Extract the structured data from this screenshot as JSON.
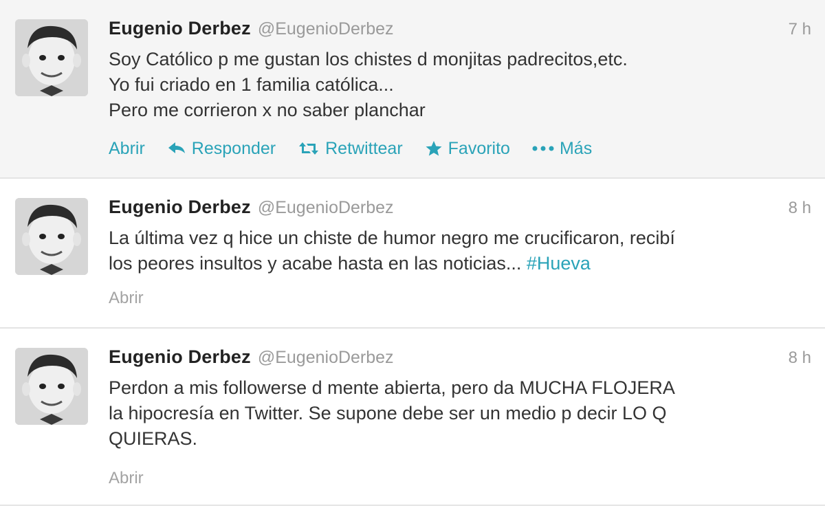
{
  "tweets": [
    {
      "fullname": "Eugenio Derbez",
      "username": "@EugenioDerbez",
      "time": "7 h",
      "lines": [
        "Soy Católico p me gustan los chistes d monjitas padrecitos,etc.",
        "Yo fui criado en 1 familia católica...",
        "Pero me corrieron x no saber planchar"
      ],
      "actions": {
        "expand": "Abrir",
        "reply": "Responder",
        "retweet": "Retwittear",
        "favorite": "Favorito",
        "more": "Más"
      }
    },
    {
      "fullname": "Eugenio Derbez",
      "username": "@EugenioDerbez",
      "time": "8 h",
      "lines": [
        "La última vez q hice un chiste de humor negro me crucificaron, recibí",
        "los peores insultos y acabe hasta en las noticias..."
      ],
      "hashtag": "#Hueva",
      "expand": "Abrir"
    },
    {
      "fullname": "Eugenio Derbez",
      "username": "@EugenioDerbez",
      "time": "8 h",
      "lines": [
        "Perdon a mis followerse d mente abierta, pero da MUCHA FLOJERA",
        "la hipocresía en Twitter. Se supone debe ser un medio p decir LO Q",
        "QUIERAS."
      ],
      "expand": "Abrir"
    }
  ],
  "colors": {
    "link": "#2aa3b8",
    "muted": "#9a9a9a",
    "hover_background": "#f5f5f5",
    "divider": "#e4e4e4"
  },
  "icons": {
    "reply": "reply-arrow-icon",
    "retweet": "retweet-icon",
    "favorite": "star-icon",
    "more": "more-dots-icon"
  }
}
